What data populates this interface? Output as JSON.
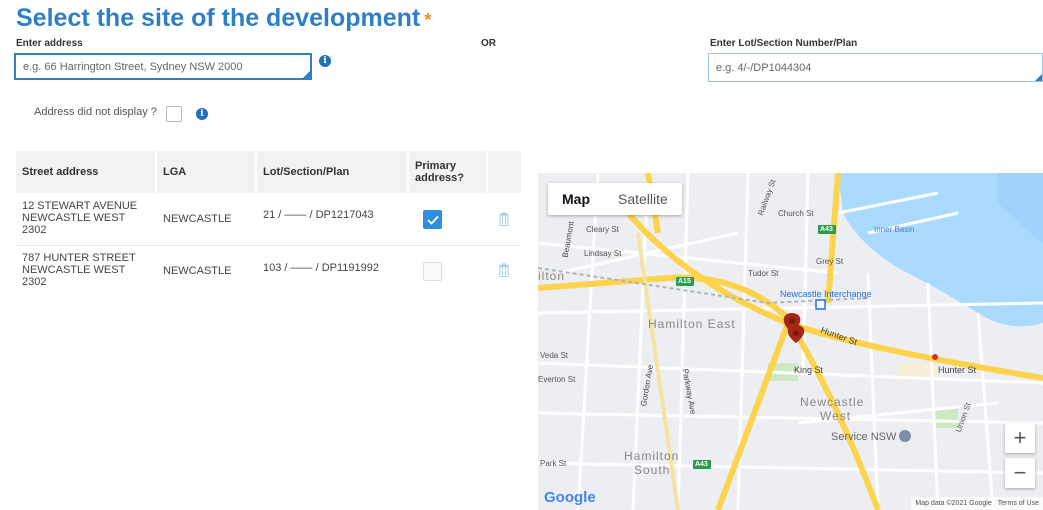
{
  "header": {
    "title": "Select the site of the development",
    "required_mark": "*"
  },
  "address": {
    "label": "Enter address",
    "placeholder": "e.g. 66 Harrington Street, Sydney NSW 2000",
    "info_icon": "info-icon"
  },
  "or_text": "OR",
  "lot": {
    "label": "Enter Lot/Section Number/Plan",
    "placeholder": "e.g. 4/-/DP1044304"
  },
  "not_display": {
    "label": "Address did not display ?",
    "checked": false
  },
  "table": {
    "columns": [
      "Street address",
      "LGA",
      "Lot/Section/Plan",
      "Primary address?"
    ],
    "rows": [
      {
        "street": [
          "12 STEWART AVENUE",
          "NEWCASTLE WEST",
          "2302"
        ],
        "lga": "NEWCASTLE",
        "lot": "21 / —— / DP1217043",
        "primary": true
      },
      {
        "street": [
          "787 HUNTER STREET",
          "NEWCASTLE WEST",
          "2302"
        ],
        "lga": "NEWCASTLE",
        "lot": "103 / —— / DP1191992",
        "primary": false
      }
    ]
  },
  "map": {
    "tabs": [
      "Map",
      "Satellite"
    ],
    "active_tab": "Map",
    "zoom_in": "+",
    "zoom_out": "−",
    "google_logo": "Google",
    "attribution": "Map data ©2021 Google",
    "terms": "Terms of Use",
    "labels": {
      "newcastle_interchange": "Newcastle Interchange",
      "hamilton_east": "Hamilton East",
      "newcastle_west_1": "Newcastle",
      "newcastle_west_2": "West",
      "hamilton_south_1": "Hamilton",
      "hamilton_south_2": "South",
      "service_nsw": "Service NSW",
      "inner_basin": "Inner Basin",
      "hunter_st": "Hunter St",
      "hunter_st_2": "Hunter St",
      "king_st": "King St",
      "parkway_ave": "Parkway Ave",
      "gordon_ave": "Gordon Ave",
      "beaumont": "Beaumont",
      "hilton": "ilton",
      "cleary": "Cleary St",
      "lindsay": "Lindsay St",
      "church": "Church St",
      "railway": "Railway St",
      "union": "Union St",
      "grey": "Grey St",
      "tudor": "Tudor St",
      "everton": "Everton St",
      "veda": "Veda St",
      "park": "Park St",
      "a43": "A43",
      "a15": "A15",
      "a43b": "A43"
    },
    "colors": {
      "water": "#aadaff",
      "road_major": "#fcd34d",
      "land": "#eceef1",
      "marker": "#a52714"
    }
  }
}
